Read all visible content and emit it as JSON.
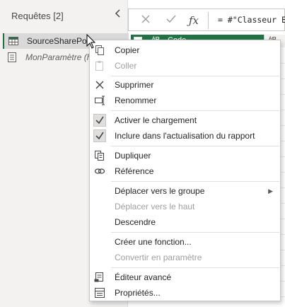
{
  "queries_pane": {
    "title": "Requêtes [2]",
    "items": [
      {
        "label": "SourceSharePoin",
        "icon": "table-icon",
        "selected": true
      },
      {
        "label": "MonParamètre (h",
        "icon": "parameter-icon",
        "selected": false
      }
    ]
  },
  "formula_bar": {
    "text": "= #\"Classeur Ex"
  },
  "grid": {
    "column_header": "Code",
    "second_column_glyph": "ᴬB"
  },
  "context_menu": {
    "items": [
      {
        "label": "Copier",
        "icon": "copy-icon",
        "disabled": false
      },
      {
        "label": "Coller",
        "icon": "paste-icon",
        "disabled": true
      },
      {
        "label": "Supprimer",
        "icon": "delete-icon",
        "disabled": false
      },
      {
        "label": "Renommer",
        "icon": "rename-icon",
        "disabled": false
      },
      {
        "label": "Activer le chargement",
        "icon": "checkmark-icon",
        "disabled": false,
        "checked": true
      },
      {
        "label": "Inclure dans l'actualisation du rapport",
        "icon": "checkmark-icon",
        "disabled": false,
        "checked": true
      },
      {
        "label": "Dupliquer",
        "icon": "duplicate-icon",
        "disabled": false
      },
      {
        "label": "Référence",
        "icon": "reference-icon",
        "disabled": false
      },
      {
        "label": "Déplacer vers le groupe",
        "icon": "",
        "disabled": false,
        "submenu": true
      },
      {
        "label": "Déplacer vers le haut",
        "icon": "",
        "disabled": true
      },
      {
        "label": "Descendre",
        "icon": "",
        "disabled": false
      },
      {
        "label": "Créer une fonction...",
        "icon": "",
        "disabled": false
      },
      {
        "label": "Convertir en paramètre",
        "icon": "",
        "disabled": true
      },
      {
        "label": "Éditeur avancé",
        "icon": "advanced-editor-icon",
        "disabled": false
      },
      {
        "label": "Propriétés...",
        "icon": "properties-icon",
        "disabled": false
      }
    ]
  },
  "colors": {
    "accent_green": "#217346",
    "disabled_text": "#a19f9d"
  }
}
